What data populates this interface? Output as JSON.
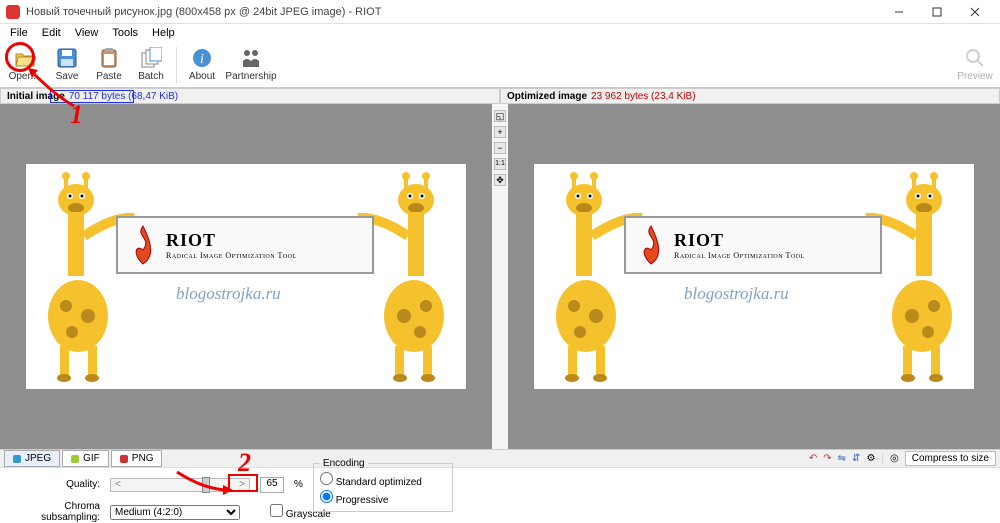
{
  "title": "Новый точечный рисунок.jpg (800x458 px @ 24bit JPEG image) - RIOT",
  "menus": {
    "file": "File",
    "edit": "Edit",
    "view": "View",
    "tools": "Tools",
    "help": "Help"
  },
  "toolbar": {
    "open": "Open...",
    "save": "Save",
    "paste": "Paste",
    "batch": "Batch",
    "about": "About",
    "partnership": "Partnership",
    "preview": "Preview"
  },
  "info": {
    "initial_lbl": "Initial image",
    "initial_val": "70 117 bytes (68,47 KiB)",
    "opt_lbl": "Optimized image",
    "opt_val": "23 962 bytes (23,4 KiB)"
  },
  "zoom": {
    "one": "1:1"
  },
  "sign": {
    "brand": "RIOT",
    "tag": "Radical Image Optimization Tool"
  },
  "canvas_url": "blogostrojka.ru",
  "tabs": {
    "jpeg": "JPEG",
    "gif": "GIF",
    "png": "PNG",
    "compress": "Compress to size"
  },
  "quality": {
    "lbl": "Quality:",
    "val": "65",
    "pct": "%"
  },
  "chroma": {
    "lbl": "Chroma subsampling:",
    "val": "Medium (4:2:0)"
  },
  "grayscale_lbl": "Grayscale",
  "encoding": {
    "legend": "Encoding",
    "std": "Standard optimized",
    "prog": "Progressive"
  },
  "annot": {
    "one": "1",
    "two": "2"
  }
}
